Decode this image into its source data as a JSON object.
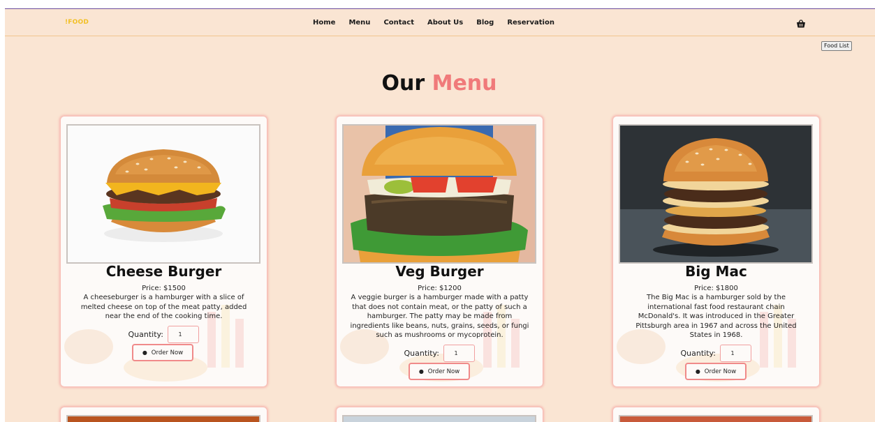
{
  "nav": {
    "brand": "!FOOD",
    "links": [
      "Home",
      "Menu",
      "Contact",
      "About Us",
      "Blog",
      "Reservation"
    ],
    "cart_icon": "shopping-basket-icon",
    "food_list_label": "Food List"
  },
  "heading": {
    "part1": "Our",
    "part2": "Menu"
  },
  "colors": {
    "page_bg": "#fae5d3",
    "accent": "#f07a7a",
    "brand": "#f2c025"
  },
  "cards": [
    {
      "title": "Cheese Burger",
      "price": "Price: $1500",
      "description": "A cheeseburger is a hamburger with a slice of melted cheese on top of the meat patty, added near the end of the cooking time.",
      "quantity_label": "Quantity:",
      "quantity_value": "1",
      "order_label": "Order Now",
      "order_icon": "burger-icon"
    },
    {
      "title": "Veg Burger",
      "price": "Price: $1200",
      "description": "A veggie burger is a hamburger made with a patty that does not contain meat, or the patty of such a hamburger. The patty may be made from ingredients like beans, nuts, grains, seeds, or fungi such as mushrooms or mycoprotein.",
      "quantity_label": "Quantity:",
      "quantity_value": "1",
      "order_label": "Order Now",
      "order_icon": "burger-icon"
    },
    {
      "title": "Big Mac",
      "price": "Price: $1800",
      "description": "The Big Mac is a hamburger sold by the international fast food restaurant chain McDonald's. It was introduced in the Greater Pittsburgh area in 1967 and across the United States in 1968.",
      "quantity_label": "Quantity:",
      "quantity_value": "1",
      "order_label": "Order Now",
      "order_icon": "burger-icon"
    }
  ]
}
